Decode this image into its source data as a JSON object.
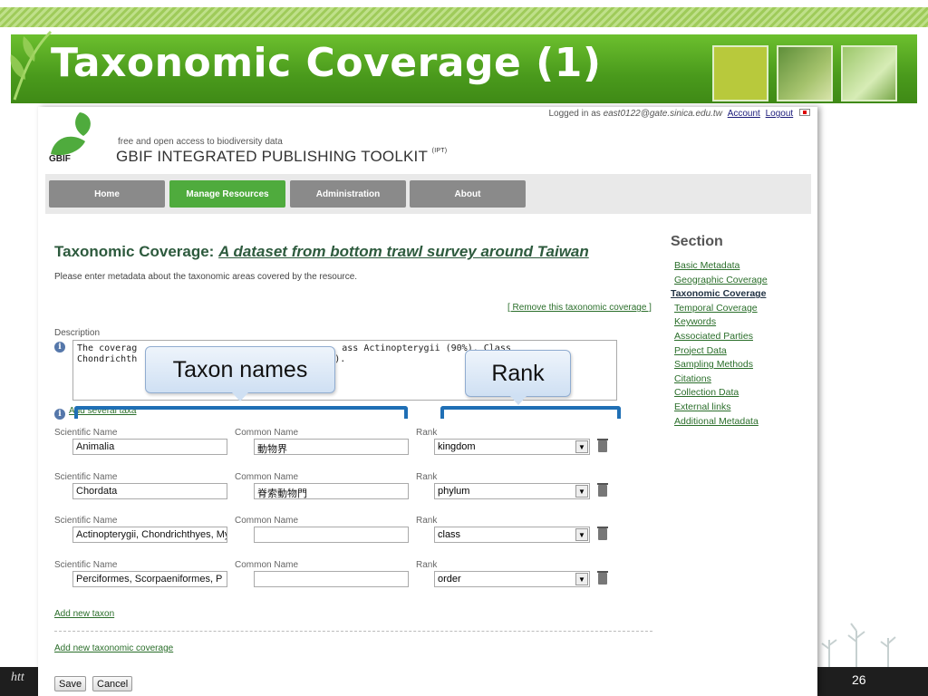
{
  "slide": {
    "title": "Taxonomic Coverage (1)",
    "page_number": "26",
    "footer_text": "htt"
  },
  "header": {
    "login_prefix": "Logged in as ",
    "login_user": "east0122@gate.sinica.edu.tw",
    "account_label": "Account",
    "logout_label": "Logout",
    "gbif_word": "GBIF",
    "tagline": "free and open access to biodiversity data",
    "toolkit_title": "GBIF INTEGRATED PUBLISHING TOOLKIT",
    "toolkit_sup": "(IPT)"
  },
  "nav": {
    "items": [
      {
        "label": "Home"
      },
      {
        "label": "Manage Resources"
      },
      {
        "label": "Administration"
      },
      {
        "label": "About"
      }
    ]
  },
  "main": {
    "heading_prefix": "Taxonomic Coverage: ",
    "dataset_title": "A dataset from bottom trawl survey around Taiwan",
    "intro": "Please enter metadata about the taxonomic areas covered by the resource.",
    "remove_link": "[ Remove this taxonomic coverage ]",
    "description_label": "Description",
    "description_line1_start": "The coverag",
    "description_line1_end": "ass Actinopterygii (90%), Class",
    "description_line2_start": "Chondrichth",
    "description_line2_end": ").",
    "add_several": "Add several taxa",
    "scientific_label": "Scientific Name",
    "common_label": "Common Name",
    "rank_label": "Rank",
    "taxa": [
      {
        "scientific": "Animalia",
        "common": "動物界",
        "rank": "kingdom"
      },
      {
        "scientific": "Chordata",
        "common": "脊索動物門",
        "rank": "phylum"
      },
      {
        "scientific": "Actinopterygii, Chondrichthyes, My",
        "common": "",
        "rank": "class"
      },
      {
        "scientific": "Perciformes, Scorpaeniformes, P",
        "common": "",
        "rank": "order"
      }
    ],
    "add_taxon": "Add new taxon",
    "add_coverage": "Add new taxonomic coverage",
    "save_label": "Save",
    "cancel_label": "Cancel"
  },
  "sidebar": {
    "heading": "Section",
    "items": [
      {
        "label": "Basic Metadata"
      },
      {
        "label": "Geographic Coverage"
      },
      {
        "label": "Taxonomic Coverage"
      },
      {
        "label": "Temporal Coverage"
      },
      {
        "label": "Keywords"
      },
      {
        "label": "Associated Parties"
      },
      {
        "label": "Project Data"
      },
      {
        "label": "Sampling Methods"
      },
      {
        "label": "Citations"
      },
      {
        "label": "Collection Data"
      },
      {
        "label": "External links"
      },
      {
        "label": "Additional Metadata"
      }
    ]
  },
  "callouts": {
    "taxon": "Taxon names",
    "rank": "Rank"
  },
  "colors": {
    "accent_green": "#4fab3d",
    "title_green": "#2d5a3d",
    "callout_blue": "#1f6fb5"
  }
}
